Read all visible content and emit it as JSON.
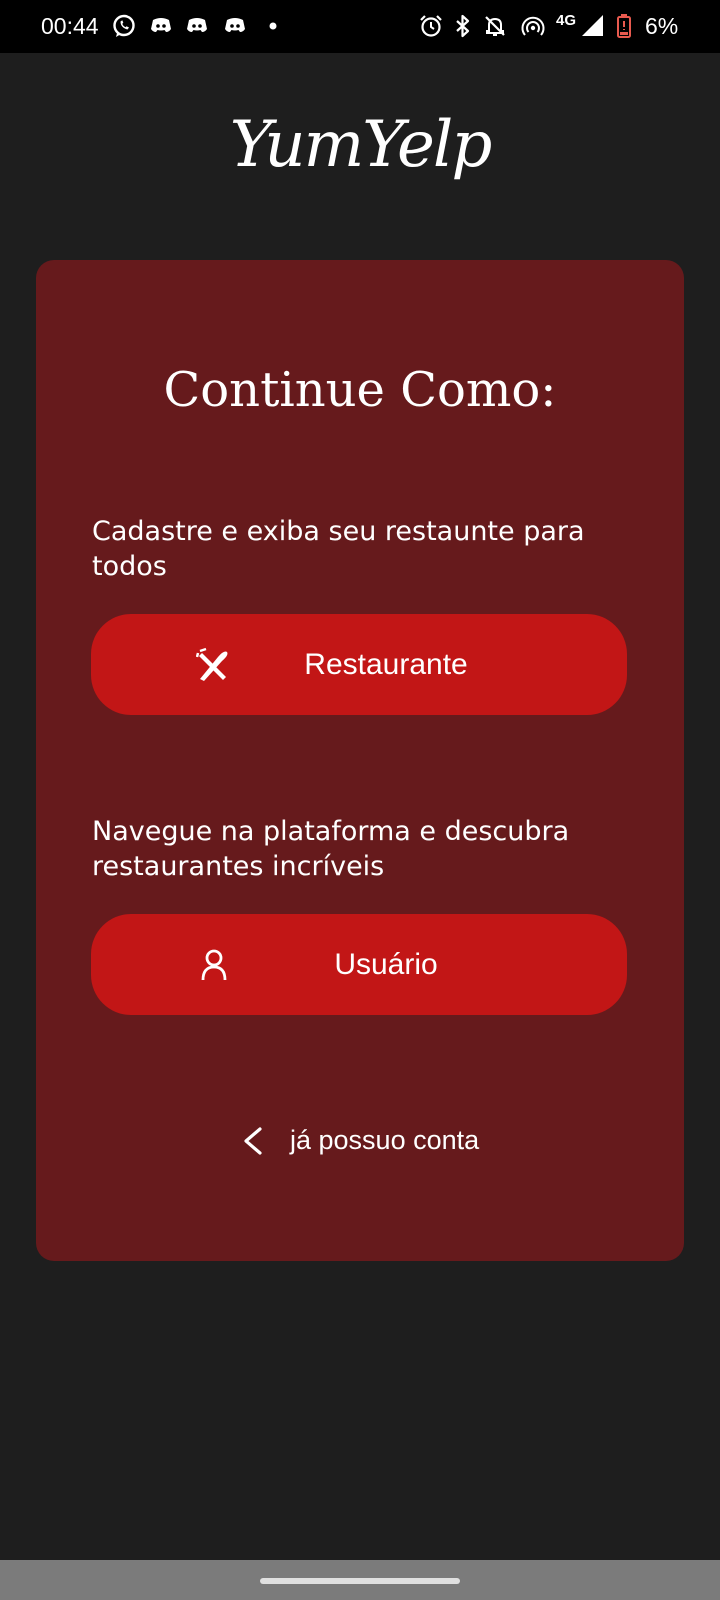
{
  "status_bar": {
    "time": "00:44",
    "network": "4G",
    "battery": "6%",
    "icons_left": [
      "whatsapp-icon",
      "discord-icon",
      "discord-icon",
      "discord-icon",
      "dot-icon"
    ],
    "icons_right": [
      "alarm-icon",
      "bluetooth-icon",
      "notifications-off-icon",
      "hotspot-icon",
      "signal-icon",
      "battery-low-icon"
    ]
  },
  "app": {
    "logo": "YumYelp"
  },
  "card": {
    "title": "Continue Como:",
    "restaurant": {
      "description": "Cadastre e exiba seu restaunte para todos",
      "button_label": "Restaurante",
      "icon": "utensils-icon"
    },
    "user": {
      "description": "Navegue na plataforma e descubra restaurantes incríveis",
      "button_label": "Usuário",
      "icon": "user-icon"
    },
    "login_link": "já possuo conta"
  },
  "colors": {
    "background": "#1e1e1e",
    "card": "#661a1c",
    "button": "#c21616",
    "text": "#ffffff"
  }
}
